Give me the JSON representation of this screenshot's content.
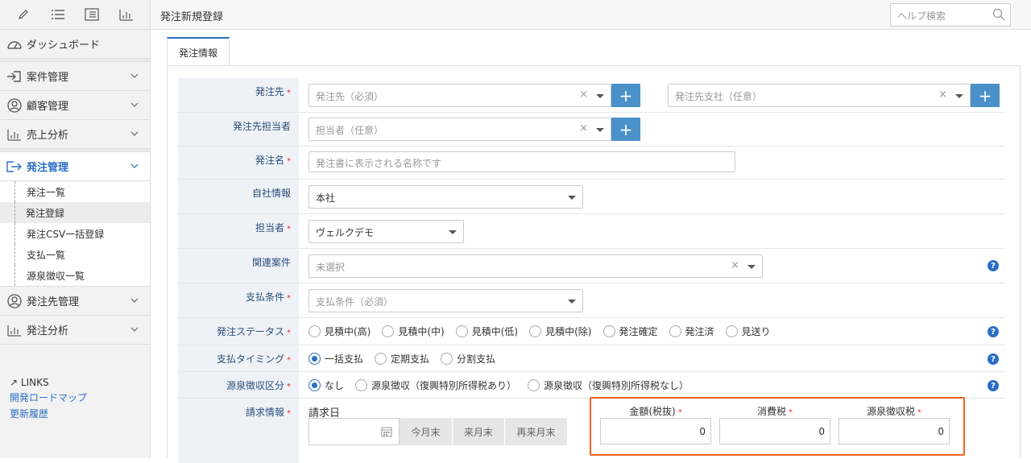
{
  "header": {
    "title": "発注新規登録",
    "help_placeholder": "ヘルプ検索"
  },
  "sidebar": {
    "dashboard": "ダッシュボード",
    "items": [
      {
        "label": "案件管理"
      },
      {
        "label": "顧客管理"
      },
      {
        "label": "売上分析"
      },
      {
        "label": "発注管理"
      },
      {
        "label": "発注先管理"
      },
      {
        "label": "発注分析"
      }
    ],
    "sub_items": [
      "発注一覧",
      "発注登録",
      "発注CSV一括登録",
      "支払一覧",
      "源泉徴収一覧"
    ],
    "links_title": "LINKS",
    "links": [
      "開発ロードマップ",
      "更新履歴"
    ]
  },
  "tab": {
    "label": "発注情報"
  },
  "form": {
    "supplier": {
      "label": "発注先",
      "placeholder": "発注先（必須）",
      "branch_placeholder": "発注先支社（任意）"
    },
    "contact": {
      "label": "発注先担当者",
      "placeholder": "担当者（任意）"
    },
    "name": {
      "label": "発注名",
      "placeholder": "発注書に表示される名称です"
    },
    "company": {
      "label": "自社情報",
      "value": "本社"
    },
    "staff": {
      "label": "担当者",
      "value": "ヴェルクデモ"
    },
    "related": {
      "label": "関連案件",
      "value": "未選択"
    },
    "payment": {
      "label": "支払条件",
      "placeholder": "支払条件（必須）"
    },
    "status": {
      "label": "発注ステータス",
      "options": [
        "見積中(高)",
        "見積中(中)",
        "見積中(低)",
        "見積中(除)",
        "発注確定",
        "発注済",
        "見送り"
      ]
    },
    "timing": {
      "label": "支払タイミング",
      "options": [
        "一括支払",
        "定期支払",
        "分割支払"
      ]
    },
    "withholding": {
      "label": "源泉徴収区分",
      "options": [
        "なし",
        "源泉徴収（復興特別所得税あり）",
        "源泉徴収（復興特別所得税なし）"
      ]
    },
    "billing": {
      "label": "請求情報",
      "date_label": "請求日",
      "buttons": [
        "今月末",
        "来月末",
        "再来月末"
      ],
      "amount_label": "金額(税抜)",
      "amount": "0",
      "tax_label": "消費税",
      "tax": "0",
      "wh_label": "源泉徴収税",
      "wh": "0"
    },
    "required_mark": "*",
    "help_mark": "?"
  }
}
